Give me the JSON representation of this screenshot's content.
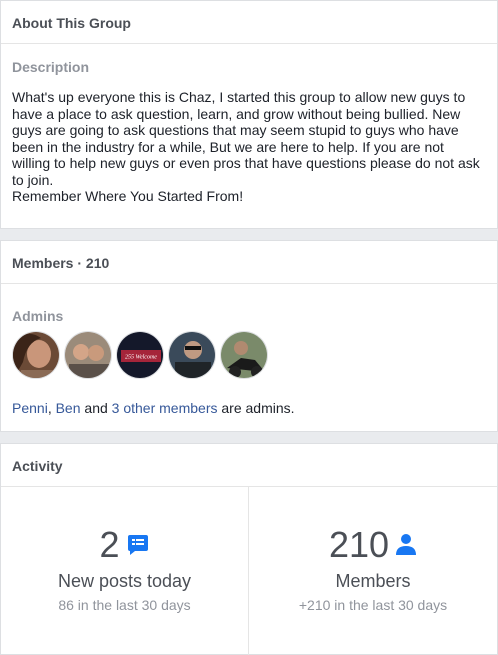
{
  "about": {
    "title": "About This Group",
    "description_heading": "Description",
    "description_lines": [
      "What's up everyone this is Chaz, I started this group to allow new guys to",
      "have a place to ask question, learn, and grow without being bullied. New",
      "guys are going to ask questions that may seem stupid to guys who have",
      "been in the industry for a while, But we are here to help. If you are not",
      "willing to help new guys or even pros that have questions please do not ask",
      "to join.",
      "Remember Where You Started From!"
    ]
  },
  "members": {
    "title": "Members · 210",
    "admins_heading": "Admins",
    "admin_avatars": [
      "avatar-1",
      "avatar-2",
      "avatar-3",
      "avatar-4",
      "avatar-5"
    ],
    "avatar3_text": "255 Welcome",
    "admins_line": {
      "name1": "Penni",
      "sep": ",",
      "name2": "Ben",
      "and": " and ",
      "others": "3 other members",
      "suffix": " are admins."
    }
  },
  "activity": {
    "title": "Activity",
    "posts": {
      "count": "2",
      "icon": "chat-bubble-icon",
      "label": "New posts today",
      "sub": "86 in the last 30 days"
    },
    "members": {
      "count": "210",
      "icon": "person-icon",
      "label": "Members",
      "sub": "+210 in the last 30 days"
    }
  },
  "colors": {
    "accent": "#1877f2",
    "link": "#365899",
    "page_bg": "#e9ebee"
  }
}
